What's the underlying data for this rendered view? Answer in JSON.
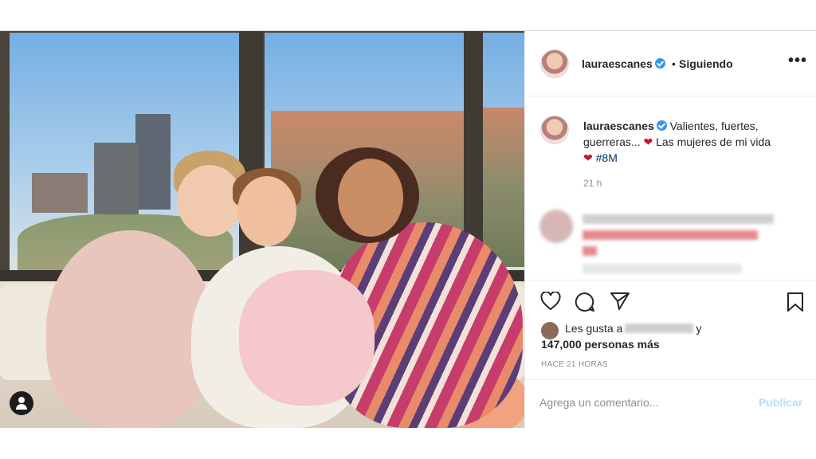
{
  "post": {
    "username": "lauraescanes",
    "separator": "•",
    "follow_status": "Siguiendo",
    "more_label": "•••"
  },
  "caption": {
    "username": "lauraescanes",
    "text_part1": "Valientes, fuertes, guerreras... ",
    "heart1": "❤",
    "text_part2": " Las mujeres de mi vida",
    "heart2": "❤",
    "hashtag": "#8M",
    "time": "21 h"
  },
  "likes": {
    "prefix": "Les gusta a",
    "suffix": "y",
    "count_text": "147,000 personas más"
  },
  "timestamp": "HACE 21 HORAS",
  "comment": {
    "placeholder": "Agrega un comentario...",
    "publish_label": "Publicar"
  },
  "icons": [
    "heart-icon",
    "comment-icon",
    "share-icon",
    "bookmark-icon",
    "verified-icon",
    "user-tag-icon"
  ],
  "colors": {
    "verified": "#3897f0",
    "publish_disabled": "#b2dffc",
    "hashtag": "#003569",
    "muted": "#8e8e8e"
  }
}
